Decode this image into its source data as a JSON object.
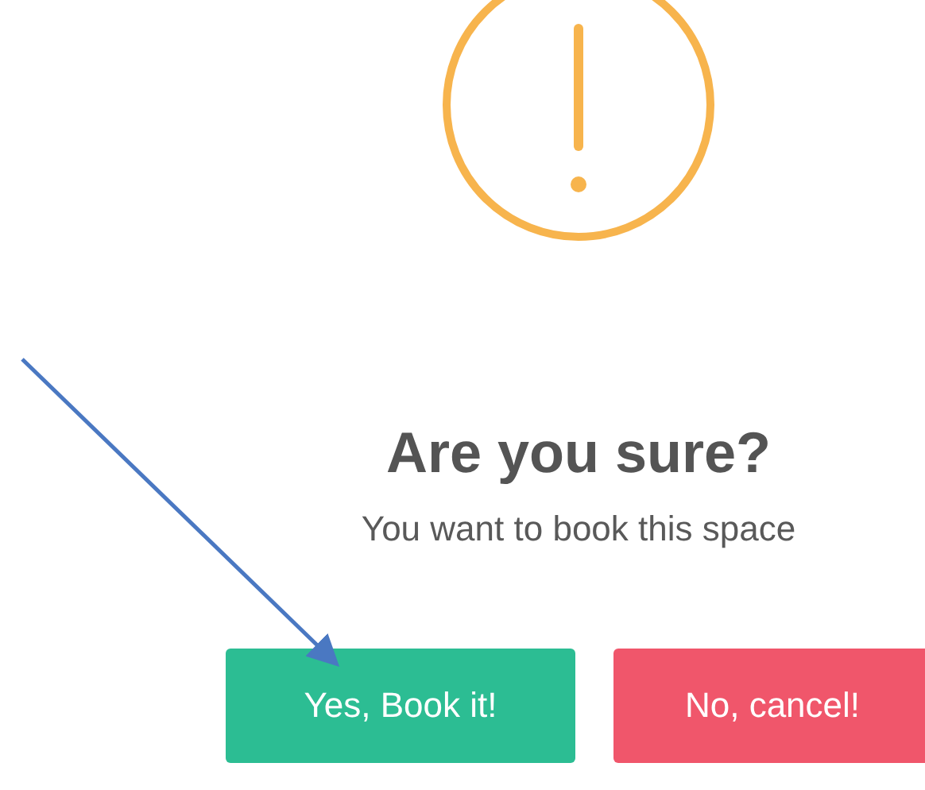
{
  "dialog": {
    "title": "Are you sure?",
    "message": "You want to book this space",
    "buttons": [
      {
        "label": "Yes, Book it!",
        "kind": "confirm"
      },
      {
        "label": "No, cancel!",
        "kind": "cancel"
      }
    ]
  }
}
